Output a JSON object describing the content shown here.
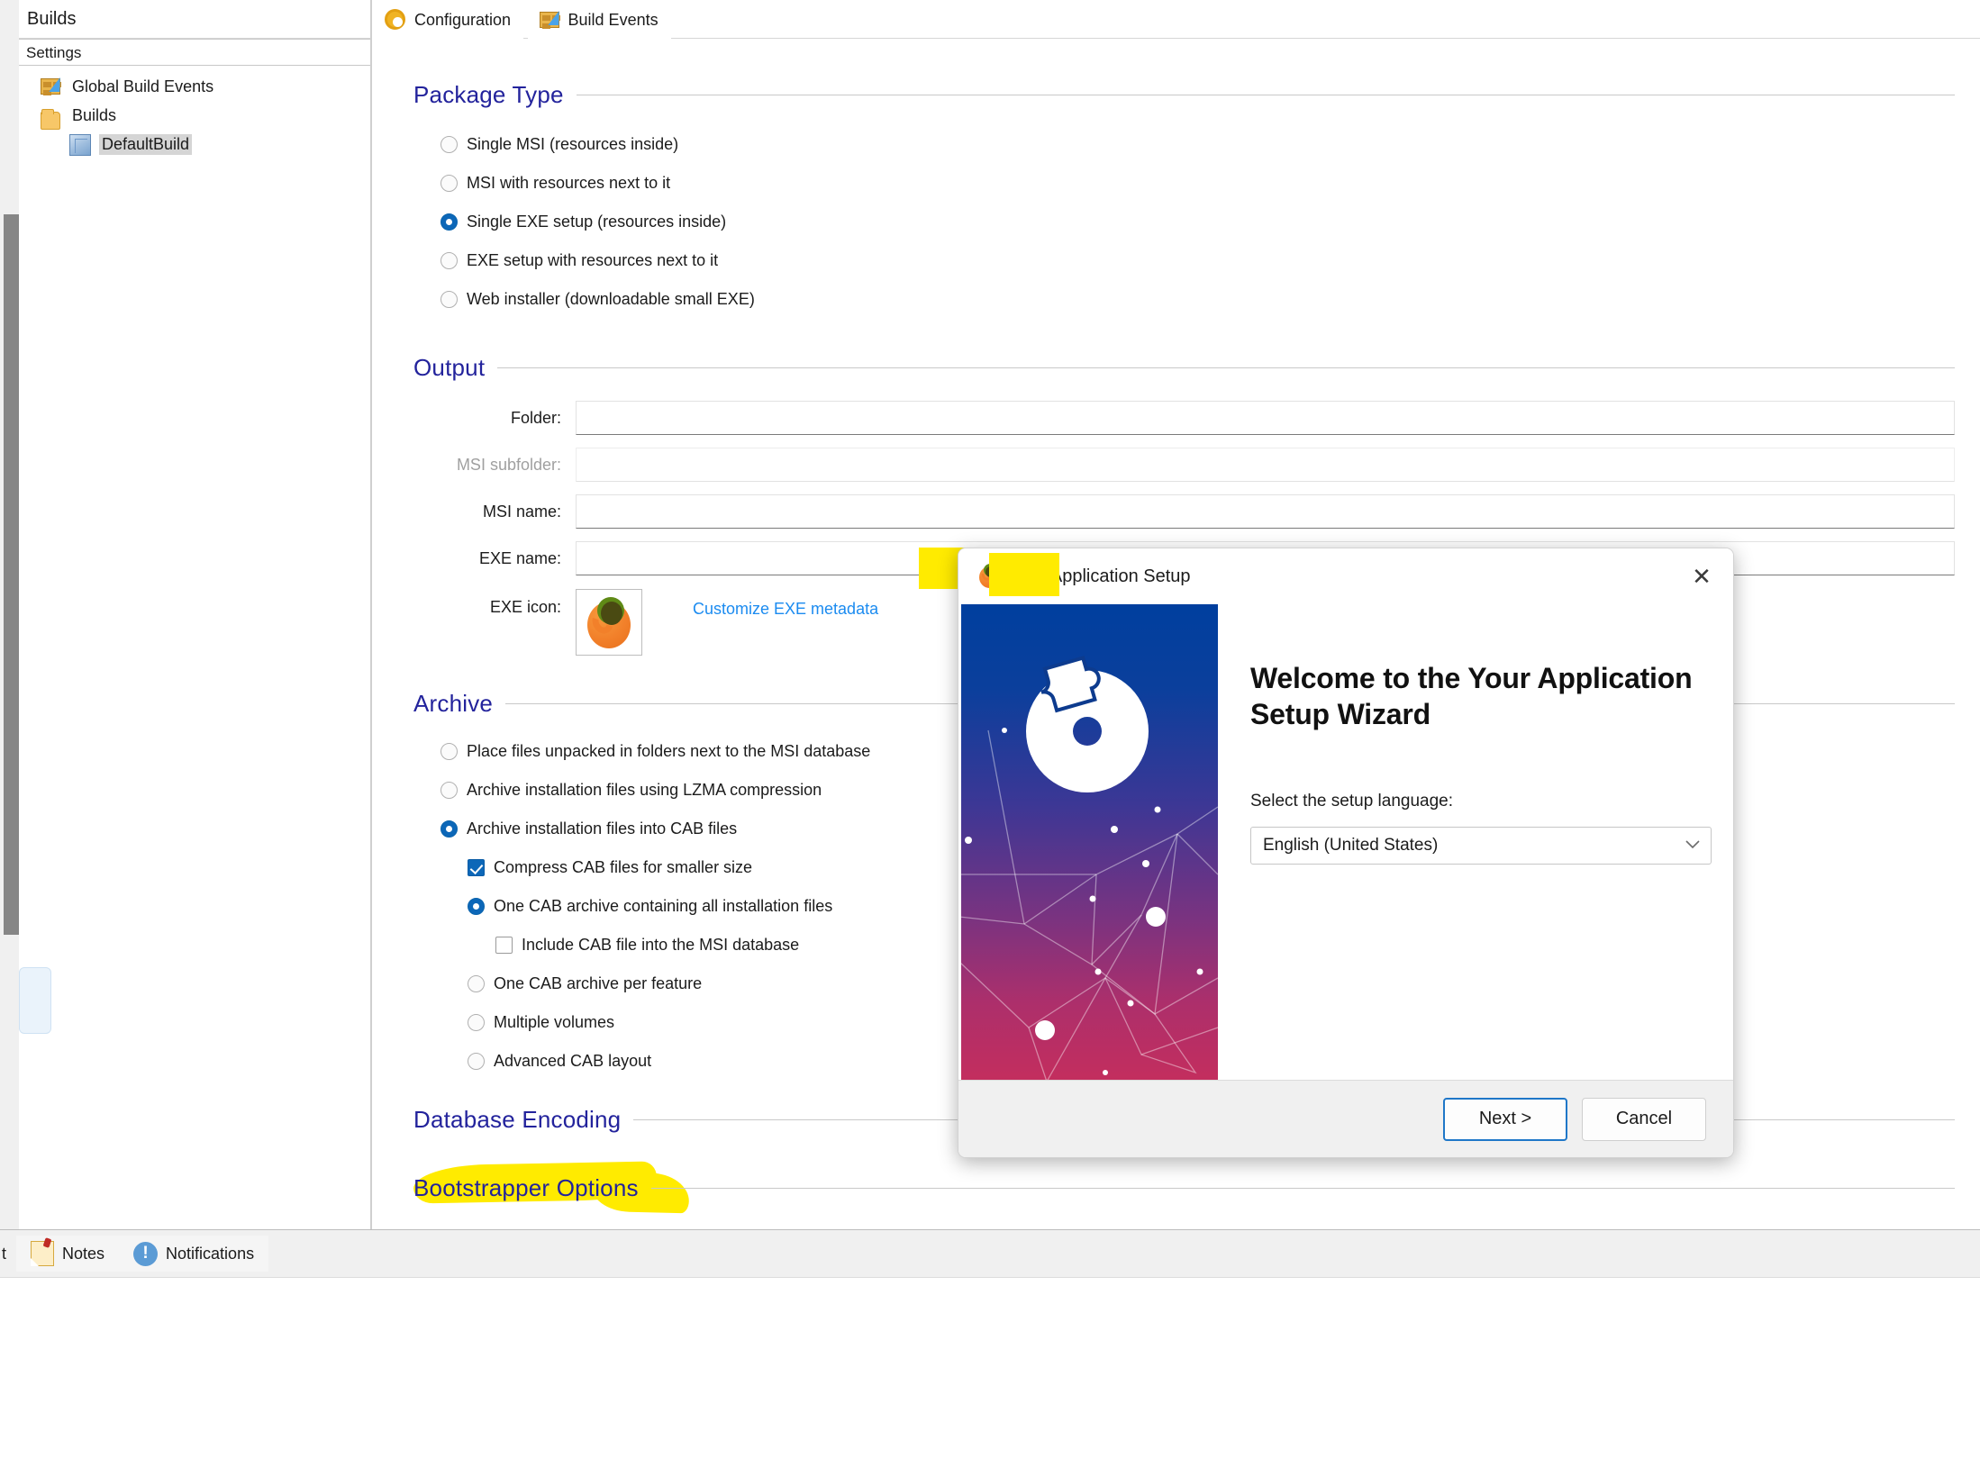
{
  "outer": {
    "scrollbar_name": "vertical-scrollbar"
  },
  "left_panel": {
    "title": "Builds",
    "column_header": "Settings",
    "tree": [
      {
        "label": "Global Build Events",
        "icon": "build-events-icon",
        "indent": 1,
        "selected": false
      },
      {
        "label": "Builds",
        "icon": "folder-icon",
        "indent": 1,
        "selected": false
      },
      {
        "label": "DefaultBuild",
        "icon": "cube-icon",
        "indent": 2,
        "selected": true
      }
    ]
  },
  "tabs": [
    {
      "label": "Configuration",
      "icon": "gear-icon",
      "active": true
    },
    {
      "label": "Build Events",
      "icon": "build-events-icon",
      "active": false
    }
  ],
  "sections": {
    "package_type": {
      "title": "Package Type",
      "options": [
        {
          "label": "Single MSI (resources inside)",
          "selected": false
        },
        {
          "label": "MSI with resources next to it",
          "selected": false
        },
        {
          "label": "Single EXE setup (resources inside)",
          "selected": true
        },
        {
          "label": "EXE setup with resources next to it",
          "selected": false
        },
        {
          "label": "Web installer (downloadable small EXE)",
          "selected": false
        }
      ]
    },
    "output": {
      "title": "Output",
      "fields": [
        {
          "label": "Folder:",
          "value": "",
          "disabled": false
        },
        {
          "label": "MSI subfolder:",
          "value": "",
          "disabled": true
        },
        {
          "label": "MSI name:",
          "value": "",
          "disabled": false
        },
        {
          "label": "EXE name:",
          "value": "",
          "disabled": false
        }
      ],
      "exe_icon_label": "EXE icon:",
      "exe_icon_name": "firefox-icon",
      "customize_link": "Customize EXE metadata"
    },
    "archive": {
      "title": "Archive",
      "options": [
        {
          "label": "Place files unpacked in folders next to the MSI database",
          "type": "radio",
          "selected": false,
          "indent": 0
        },
        {
          "label": "Archive installation files using LZMA compression",
          "type": "radio",
          "selected": false,
          "indent": 0
        },
        {
          "label": "Archive installation files into CAB files",
          "type": "radio",
          "selected": true,
          "indent": 0
        },
        {
          "label": "Compress CAB files for smaller size",
          "type": "checkbox",
          "selected": true,
          "indent": 1
        },
        {
          "label": "One CAB archive containing all installation files",
          "type": "radio",
          "selected": true,
          "indent": 1
        },
        {
          "label": "Include CAB file into the MSI database",
          "type": "checkbox",
          "selected": false,
          "indent": 2
        },
        {
          "label": "One CAB archive per feature",
          "type": "radio",
          "selected": false,
          "indent": 1
        },
        {
          "label": "Multiple volumes",
          "type": "radio",
          "selected": false,
          "indent": 1
        },
        {
          "label": "Advanced CAB layout",
          "type": "radio",
          "selected": false,
          "indent": 1
        }
      ]
    },
    "database_encoding": {
      "title": "Database Encoding"
    },
    "bootstrapper_options": {
      "title": "Bootstrapper Options"
    }
  },
  "dialog": {
    "title": "Your Application Setup",
    "title_icon": "firefox-icon",
    "close_label": "✕",
    "heading": "Welcome to the Your Application Setup Wizard",
    "language_label": "Select the setup language:",
    "language_value": "English (United States)",
    "chevron": "⌄",
    "buttons": [
      {
        "label": "Next >",
        "primary": true
      },
      {
        "label": "Cancel",
        "primary": false
      }
    ]
  },
  "statusbar": {
    "cut_text": "t",
    "items": [
      {
        "label": "Notes",
        "icon": "notes-icon"
      },
      {
        "label": "Notifications",
        "icon": "notifications-icon"
      }
    ]
  },
  "colors": {
    "section_heading": "#23239c",
    "accent_blue": "#0c67b8",
    "link_blue": "#1b8bf0",
    "highlight_yellow": "#ffeb00",
    "banner_top": "#003f9e",
    "banner_bottom": "#c32e5e"
  }
}
